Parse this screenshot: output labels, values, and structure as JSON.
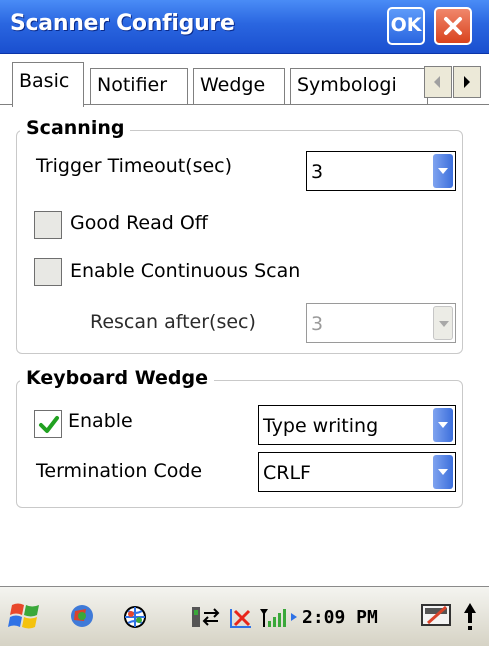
{
  "window": {
    "title": "Scanner Configure",
    "ok_label": "OK"
  },
  "tabs": [
    {
      "label": "Basic"
    },
    {
      "label": "Notifier"
    },
    {
      "label": "Wedge"
    },
    {
      "label": "Symbologi"
    }
  ],
  "scanning": {
    "title": "Scanning",
    "trigger_timeout_label": "Trigger Timeout(sec)",
    "trigger_timeout_value": "3",
    "good_read_off_label": "Good Read Off",
    "enable_continuous_scan_label": "Enable Continuous Scan",
    "rescan_after_label": "Rescan after(sec)",
    "rescan_after_value": "3"
  },
  "keyboard_wedge": {
    "title": "Keyboard Wedge",
    "enable_label": "Enable",
    "mode_value": "Type writing",
    "termination_code_label": "Termination Code",
    "termination_code_value": "CRLF"
  },
  "taskbar": {
    "time": "2:09 PM"
  },
  "colors": {
    "titlebar": "#2a66e0",
    "close": "#d9431e",
    "checkmark": "#21a121"
  }
}
